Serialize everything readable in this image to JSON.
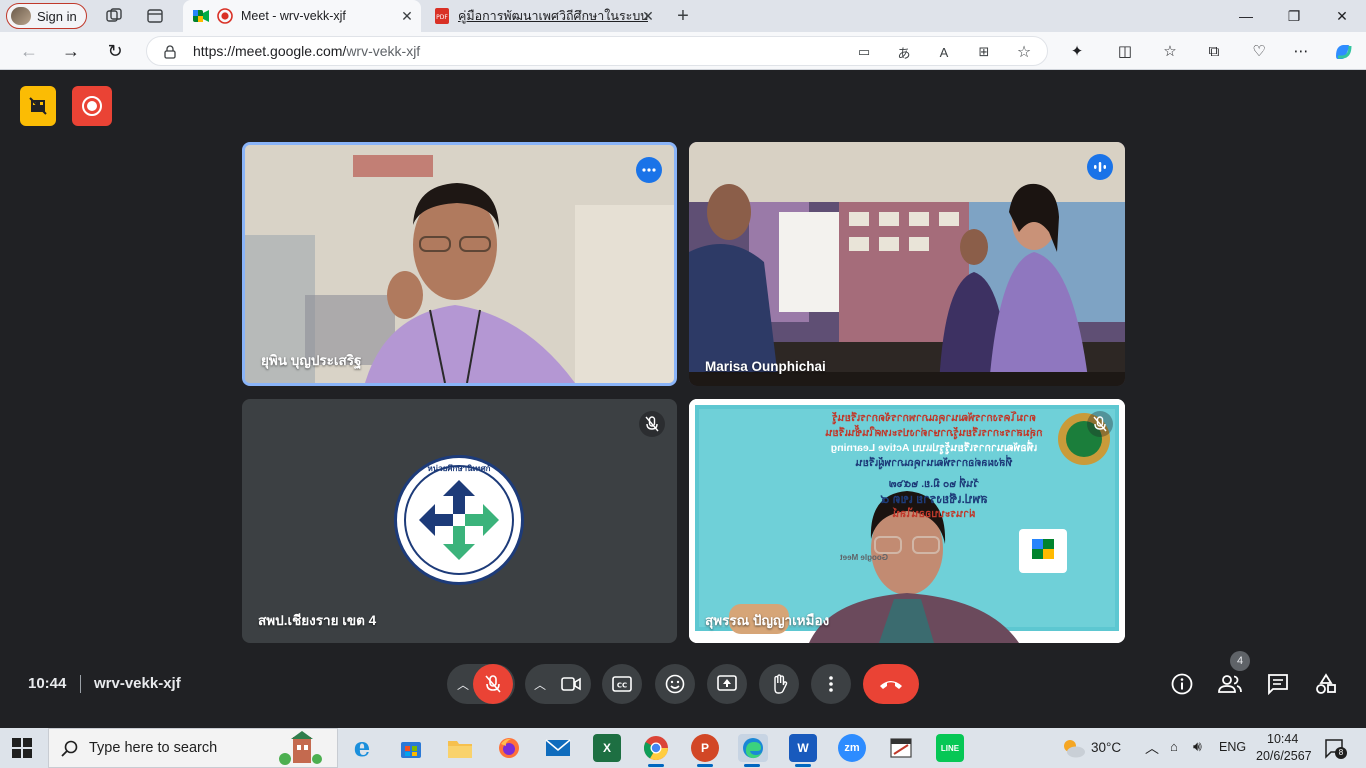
{
  "browser": {
    "profile_label": "Sign in",
    "tabs": [
      {
        "title": "Meet - wrv-vekk-xjf",
        "active": true
      },
      {
        "title": "คู่มือการพัฒนาเพศวิถีศึกษาในระบบก"
      }
    ],
    "url_host": "https://meet.google.com/",
    "url_path": "wrv-vekk-xjf"
  },
  "meet": {
    "participants": [
      {
        "name": "ยุพิน บุญประเสริฐ"
      },
      {
        "name": "Marisa Ounphichai"
      },
      {
        "name": "สพป.เชียงราย เขต 4"
      },
      {
        "name": "สุพรรณ ปัญญาเหมือง"
      }
    ],
    "logo_text_top": "หน่วยศึกษานิเทศก์",
    "slide_lines": [
      "ตามโครงการพัฒนาคุณภาพการจัดการเรียนรู้",
      "กลุ่มสาระการเรียนรู้ภาษาต่างประเทศในชั้นเรียน",
      "เพื่อพัฒนาการเรียนรู้รูปแบบ Active Learning",
      "ที่ส่งผลต่อการพัฒนาคุณภาพผู้เรียน",
      "วันที่ ๒๐ มิ.ย. ๒๕๖๗",
      "สพป.เชียงราย เขต ๔",
      "ผ่านระบบออนไลน์",
      "Google Meet"
    ],
    "time": "10:44",
    "meeting_code": "wrv-vekk-xjf",
    "participant_count": "4"
  },
  "taskbar": {
    "search_placeholder": "Type here to search",
    "weather": "30°C",
    "language": "ENG",
    "clock_time": "10:44",
    "clock_date": "20/6/2567",
    "notification_count": "8",
    "zoom_label": "zm"
  },
  "colors": {
    "meet_bg": "#202124",
    "end_call": "#ea4335",
    "active_tile_border": "#8ab4f8",
    "badge_yellow": "#fbbc04",
    "badge_red": "#ea4335"
  }
}
